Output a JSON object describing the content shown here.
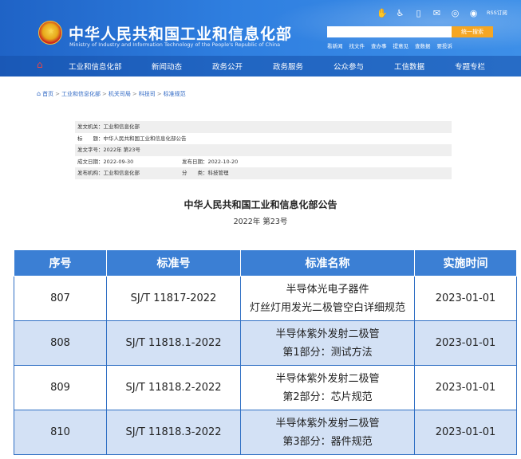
{
  "header": {
    "title": "中华人民共和国工业和信息化部",
    "subtitle": "Ministry of Industry and Information Technology of the People's Republic of China",
    "rss": "RSS订阅",
    "search_button": "统一搜索",
    "quick_links": [
      "看新闻",
      "找文件",
      "查办事",
      "提意见",
      "查数据",
      "要投诉"
    ]
  },
  "nav": {
    "items": [
      "工业和信息化部",
      "新闻动态",
      "政务公开",
      "政务服务",
      "公众参与",
      "工信数据",
      "专题专栏"
    ]
  },
  "breadcrumb": {
    "items": [
      "首页",
      "工业和信息化部",
      "机关司局",
      "科技司",
      "标准规范"
    ],
    "separator": ">"
  },
  "meta": {
    "issuer_label": "发文机关：工业和信息化部",
    "title_label": "标　　题：中华人民共和国工业和信息化部公告",
    "doc_no_label": "发文字号：2022年 第23号",
    "created_label": "成文日期：2022-09-30",
    "published_label": "发布日期：2022-10-20",
    "publisher_label": "发布机构：工业和信息化部",
    "category_label": "分　　类：科技管理"
  },
  "document": {
    "title": "中华人民共和国工业和信息化部公告",
    "number": "2022年 第23号"
  },
  "table": {
    "headers": [
      "序号",
      "标准号",
      "标准名称",
      "实施时间"
    ],
    "rows": [
      {
        "no": "807",
        "code": "SJ/T 11817-2022",
        "name_line1": "半导体光电子器件",
        "name_line2": "灯丝灯用发光二极管空白详细规范",
        "date": "2023-01-01"
      },
      {
        "no": "808",
        "code": "SJ/T 11818.1-2022",
        "name_line1": "半导体紫外发射二极管",
        "name_line2": "第1部分：测试方法",
        "date": "2023-01-01"
      },
      {
        "no": "809",
        "code": "SJ/T 11818.2-2022",
        "name_line1": "半导体紫外发射二极管",
        "name_line2": "第2部分：芯片规范",
        "date": "2023-01-01"
      },
      {
        "no": "810",
        "code": "SJ/T 11818.3-2022",
        "name_line1": "半导体紫外发射二极管",
        "name_line2": "第3部分：器件规范",
        "date": "2023-01-01"
      }
    ]
  },
  "colors": {
    "header_blue": "#2f7fe0",
    "table_header": "#3b7fd4",
    "row_shade": "#d3e1f5",
    "search_button": "#f5a623"
  }
}
